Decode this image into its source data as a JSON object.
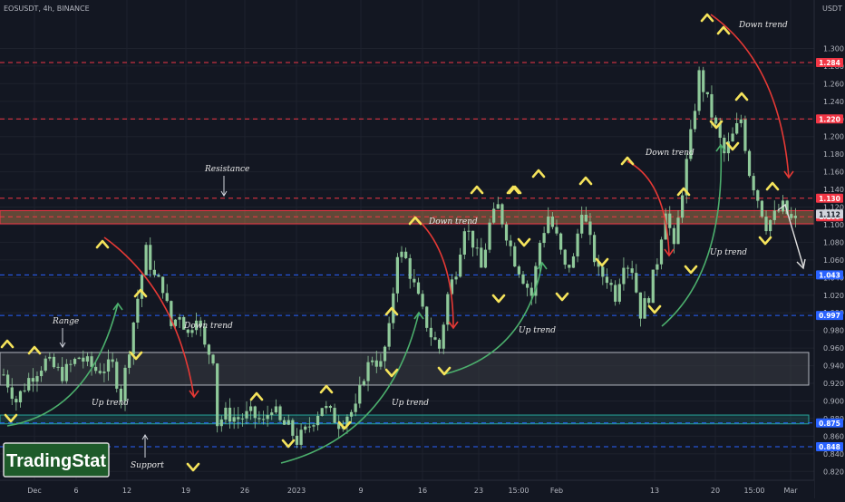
{
  "symbol_text": "EOSUSDT, 4h, BINANCE",
  "currency": "USDT",
  "brand": "TradingStat",
  "colors": {
    "bg": "#131722",
    "grid": "#1e222d",
    "candle": "#8fc99a",
    "red_line": "#f23645",
    "blue_line": "#2962ff",
    "up_arrow": "#f5e35b",
    "trend_up": "#4caf6d",
    "trend_down": "#e53935",
    "zone_fill": "#3a3d44",
    "zone_border": "#b2b5be",
    "support_zone": "#26a69a",
    "resistance_zone": "#f2a35f",
    "brand_bg": "#1e5b2a"
  },
  "chart_data": {
    "type": "candlestick",
    "ylim": [
      0.81,
      1.355
    ],
    "y_ticks": [
      "1.300",
      "1.280",
      "1.260",
      "1.240",
      "1.220",
      "1.200",
      "1.180",
      "1.160",
      "1.140",
      "1.120",
      "1.100",
      "1.080",
      "1.060",
      "1.040",
      "1.020",
      "1.000",
      "0.980",
      "0.960",
      "0.940",
      "0.920",
      "0.900",
      "0.880",
      "0.860",
      "0.840",
      "0.820"
    ],
    "x_ticks": [
      "Dec",
      "6",
      "12",
      "19",
      "26",
      "2023",
      "9",
      "16",
      "23",
      "15:00",
      "Feb",
      "13",
      "20",
      "15:00",
      "Mar"
    ],
    "close_path": [
      [
        0,
        0.93
      ],
      [
        3,
        0.9
      ],
      [
        6,
        0.925
      ],
      [
        10,
        0.945
      ],
      [
        14,
        0.93
      ],
      [
        18,
        0.95
      ],
      [
        22,
        0.935
      ],
      [
        26,
        0.94
      ],
      [
        28,
        0.905
      ],
      [
        31,
        0.99
      ],
      [
        34,
        1.07
      ],
      [
        36,
        1.04
      ],
      [
        38,
        1.03
      ],
      [
        40,
        0.985
      ],
      [
        42,
        1.0
      ],
      [
        44,
        0.975
      ],
      [
        46,
        1.0
      ],
      [
        48,
        0.96
      ],
      [
        50,
        0.95
      ],
      [
        51,
        0.875
      ],
      [
        53,
        0.885
      ],
      [
        56,
        0.88
      ],
      [
        59,
        0.885
      ],
      [
        62,
        0.875
      ],
      [
        64,
        0.895
      ],
      [
        66,
        0.875
      ],
      [
        68,
        0.87
      ],
      [
        70,
        0.855
      ],
      [
        72,
        0.865
      ],
      [
        74,
        0.88
      ],
      [
        76,
        0.895
      ],
      [
        78,
        0.885
      ],
      [
        80,
        0.875
      ],
      [
        82,
        0.885
      ],
      [
        84,
        0.89
      ],
      [
        86,
        0.93
      ],
      [
        88,
        0.95
      ],
      [
        90,
        0.94
      ],
      [
        92,
        0.98
      ],
      [
        94,
        1.07
      ],
      [
        96,
        1.06
      ],
      [
        98,
        1.03
      ],
      [
        100,
        1.0
      ],
      [
        102,
        0.975
      ],
      [
        104,
        0.96
      ],
      [
        106,
        1.02
      ],
      [
        108,
        1.05
      ],
      [
        110,
        1.1
      ],
      [
        112,
        1.08
      ],
      [
        114,
        1.05
      ],
      [
        116,
        1.1
      ],
      [
        118,
        1.12
      ],
      [
        120,
        1.09
      ],
      [
        122,
        1.06
      ],
      [
        124,
        1.04
      ],
      [
        126,
        1.02
      ],
      [
        128,
        1.08
      ],
      [
        130,
        1.11
      ],
      [
        132,
        1.085
      ],
      [
        134,
        1.05
      ],
      [
        136,
        1.06
      ],
      [
        138,
        1.12
      ],
      [
        140,
        1.08
      ],
      [
        142,
        1.045
      ],
      [
        144,
        1.04
      ],
      [
        146,
        1.02
      ],
      [
        148,
        1.06
      ],
      [
        150,
        1.05
      ],
      [
        152,
        1.0
      ],
      [
        154,
        1.02
      ],
      [
        156,
        1.06
      ],
      [
        158,
        1.12
      ],
      [
        160,
        1.07
      ],
      [
        162,
        1.14
      ],
      [
        164,
        1.2
      ],
      [
        166,
        1.27
      ],
      [
        168,
        1.24
      ],
      [
        170,
        1.21
      ],
      [
        172,
        1.18
      ],
      [
        174,
        1.2
      ],
      [
        176,
        1.22
      ],
      [
        178,
        1.16
      ],
      [
        180,
        1.13
      ],
      [
        182,
        1.1
      ],
      [
        184,
        1.11
      ],
      [
        186,
        1.12
      ],
      [
        188,
        1.105
      ]
    ],
    "horizontal_levels": [
      {
        "value": 1.284,
        "label": "1.284",
        "color": "red"
      },
      {
        "value": 1.22,
        "label": "1.220",
        "color": "red"
      },
      {
        "value": 1.13,
        "label": "1.130",
        "color": "red"
      },
      {
        "value": 1.109,
        "label": "1.109",
        "color": "red"
      },
      {
        "value": 1.043,
        "label": "1.043",
        "color": "blue"
      },
      {
        "value": 0.997,
        "label": "0.997",
        "color": "blue"
      },
      {
        "value": 0.875,
        "label": "0.875",
        "color": "blue"
      },
      {
        "value": 0.848,
        "label": "0.848",
        "color": "blue"
      }
    ],
    "current_price": "1.112",
    "zones": [
      {
        "name": "range-zone",
        "y1": 0.955,
        "y2": 0.918
      },
      {
        "name": "support-zone",
        "y1": 0.884,
        "y2": 0.874
      },
      {
        "name": "resistance-zone",
        "y1": 1.116,
        "y2": 1.101
      }
    ],
    "annotations": [
      "Resistance",
      "Range",
      "Down trend",
      "Up trend",
      "Support",
      "Down trend",
      "Up trend",
      "Up trend",
      "Down trend",
      "Up trend",
      "Down trend"
    ]
  }
}
